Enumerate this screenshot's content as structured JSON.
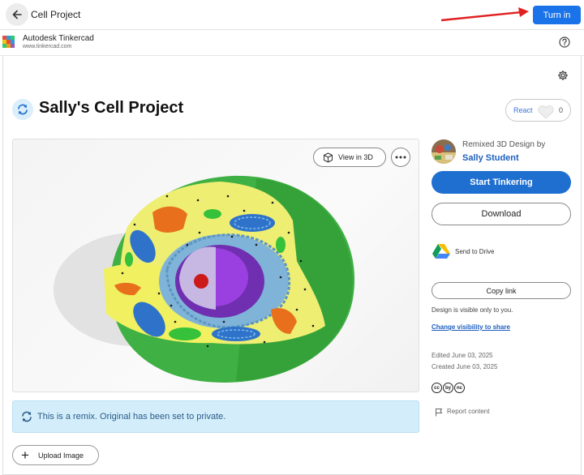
{
  "topbar": {
    "title": "Cell Project",
    "turn_in_label": "Turn in",
    "accent": "#1a73e8",
    "arrow_color": "#e02020"
  },
  "appbar": {
    "app_name": "Autodesk Tinkercad",
    "app_url": "www.tinkercad.com"
  },
  "design": {
    "title": "Sally's Cell Project",
    "react_label": "React",
    "react_count": "0",
    "view_in_3d_label": "View in 3D",
    "remix_notice": "This is a remix. Original has been set to private.",
    "upload_label": "Upload Image"
  },
  "sidebar": {
    "remixed_by_label": "Remixed 3D Design by",
    "author": "Sally Student",
    "start_label": "Start Tinkering",
    "download_label": "Download",
    "drive_label": "Send to Drive",
    "copy_link_label": "Copy link",
    "visibility_note": "Design is visible only to you.",
    "change_visibility_label": "Change visibility to share",
    "edited": "Edited June 03, 2025",
    "created": "Created June 03, 2025",
    "cc_icons": [
      "cc",
      "by",
      "nc"
    ],
    "report_label": "Report content"
  },
  "icons": {
    "back": "arrow-left-icon",
    "help": "question-circle-icon",
    "settings": "gear-icon",
    "remix": "remix-icon",
    "heart": "heart-icon",
    "cube": "cube-icon",
    "more": "more-horizontal-icon",
    "drive": "google-drive-icon",
    "flag": "flag-icon",
    "plus": "plus-icon"
  }
}
